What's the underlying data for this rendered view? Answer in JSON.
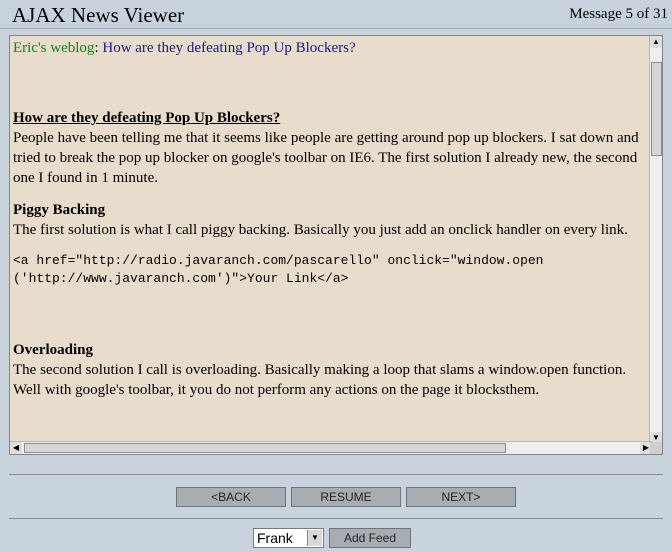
{
  "app": {
    "title": "AJAX News Viewer",
    "message_counter": "Message 5 of 31"
  },
  "message": {
    "feed_name": "Eric's weblog",
    "separator": ":",
    "item_title": "How are they defeating Pop Up Blockers?",
    "heading": "How are they defeating Pop Up Blockers?",
    "intro": "People have been telling me that it seems like people are getting around pop up blockers. I sat down and tried to break the pop up blocker on google's toolbar on IE6. The first solution I already new, the second one I found in 1 minute.",
    "section1_title": "Piggy Backing",
    "section1_text": "The first solution is what I call piggy backing. Basically you just add an onclick handler on every link.",
    "code_line1": "<a href=\"http://radio.javaranch.com/pascarello\" onclick=\"window.open",
    "code_line2": "('http://www.javaranch.com')\">Your Link</a>",
    "section2_title": "Overloading",
    "section2_text": "The second solution I call is overloading. Basically making a loop that slams a window.open function. Well with google's toolbar, it you do not perform any actions on the page it blocksthem."
  },
  "nav": {
    "back": "<BACK",
    "resume": "RESUME",
    "next": "NEXT>"
  },
  "feed_selector": {
    "selected": "Frank",
    "add_label": "Add Feed"
  },
  "icons": {
    "scroll_up": "triangle-up",
    "scroll_down": "triangle-down",
    "scroll_left": "triangle-left",
    "scroll_right": "triangle-right",
    "dropdown": "triangle-down"
  }
}
